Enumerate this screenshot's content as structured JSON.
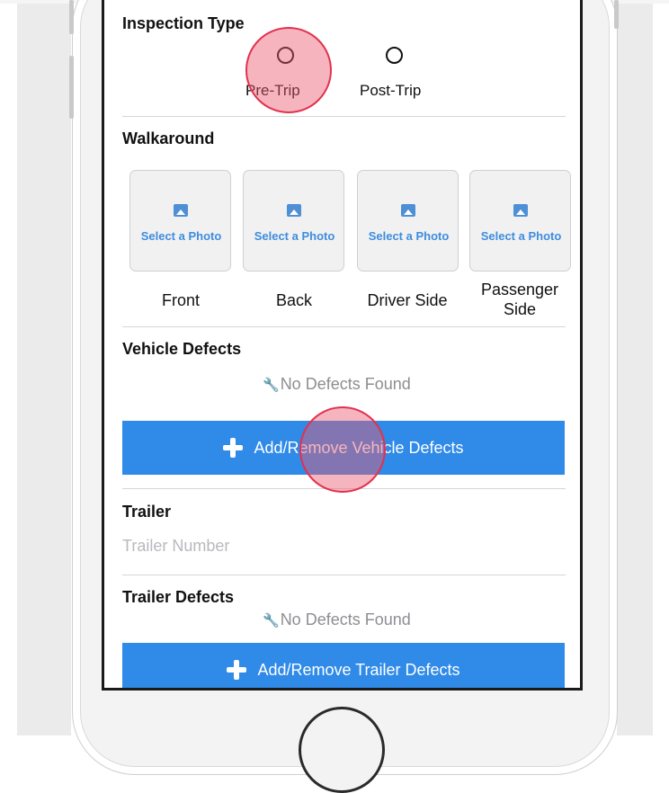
{
  "inspection_type": {
    "title": "Inspection Type",
    "options": [
      {
        "label": "Pre-Trip",
        "selected": false
      },
      {
        "label": "Post-Trip",
        "selected": false
      }
    ]
  },
  "walkaround": {
    "title": "Walkaround",
    "photo_prompt": "Select a Photo",
    "tiles": [
      {
        "label": "Front"
      },
      {
        "label": "Back"
      },
      {
        "label": "Driver Side"
      },
      {
        "label": "Passenger Side"
      }
    ]
  },
  "vehicle_defects": {
    "title": "Vehicle Defects",
    "empty_text": "No Defects Found",
    "button_label": "Add/Remove Vehicle Defects"
  },
  "trailer": {
    "title": "Trailer",
    "value": "",
    "placeholder": "Trailer Number"
  },
  "trailer_defects": {
    "title": "Trailer Defects",
    "empty_text": "No Defects Found",
    "button_label": "Add/Remove Trailer Defects"
  },
  "colors": {
    "accent": "#2f8ae8",
    "photo_prompt": "#3e8ddf",
    "touch_indicator": "#e2314f"
  }
}
